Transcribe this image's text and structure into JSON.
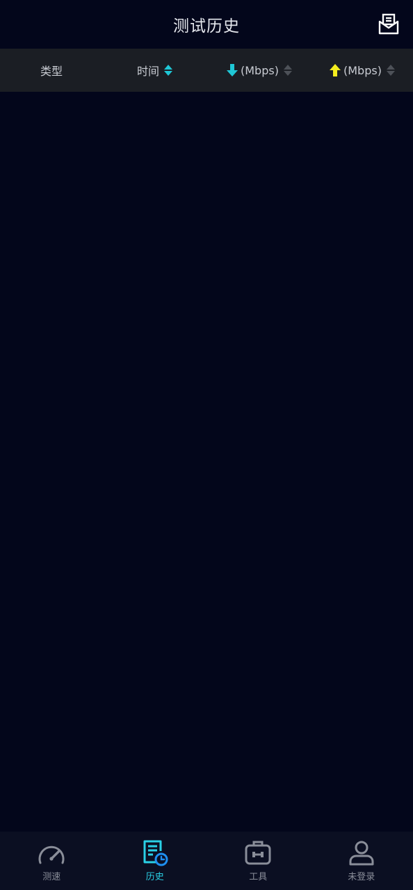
{
  "header": {
    "title": "测试历史"
  },
  "columns": [
    {
      "label": "类型"
    },
    {
      "label": "时间"
    },
    {
      "label": "(Mbps)"
    },
    {
      "label": "(Mbps)"
    }
  ],
  "colors": {
    "accent": "#1fc7d6",
    "download_arrow": "#1fc7d6",
    "upload_arrow": "#f4ec1e",
    "background": "#03061b",
    "header_row": "#1b1e24"
  },
  "tabs": [
    {
      "label": "测速",
      "icon": "speedometer-icon"
    },
    {
      "label": "历史",
      "icon": "history-icon",
      "active": true
    },
    {
      "label": "工具",
      "icon": "toolbox-icon"
    },
    {
      "label": "未登录",
      "icon": "user-icon"
    }
  ]
}
